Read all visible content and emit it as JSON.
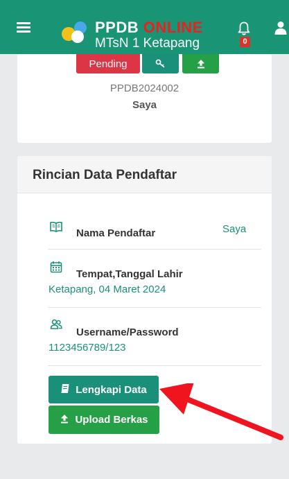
{
  "header": {
    "brand_part1": "PPDB",
    "brand_part2": "ONLINE",
    "subtitle": "MTsN 1 Ketapang",
    "notification_count": "0",
    "icons": [
      "menu-icon",
      "logo-icon",
      "bell-icon",
      "user-icon"
    ]
  },
  "profile_card": {
    "status_button_label": "Pending",
    "key_button_icon": "key-icon",
    "upload_button_icon": "upload-icon",
    "registration_id": "PPDB2024002",
    "name": "Saya"
  },
  "details": {
    "title": "Rincian Data Pendaftar",
    "rows": [
      {
        "icon": "book-icon",
        "label": "Nama Pendaftar",
        "value": "Saya"
      },
      {
        "icon": "calendar-icon",
        "label": "Tempat,Tanggal Lahir",
        "value": "Ketapang, 04 Maret 2024"
      },
      {
        "icon": "users-icon",
        "label": "Username/Password",
        "value": "1123456789/123"
      }
    ],
    "complete_button_label": "Lengkapi Data",
    "upload_button_label": "Upload Berkas"
  },
  "colors": {
    "primary": "#199475",
    "accent_red": "#e8221f",
    "danger": "#dc3545",
    "success": "#26a046",
    "annotation_arrow": "#f0141e"
  }
}
